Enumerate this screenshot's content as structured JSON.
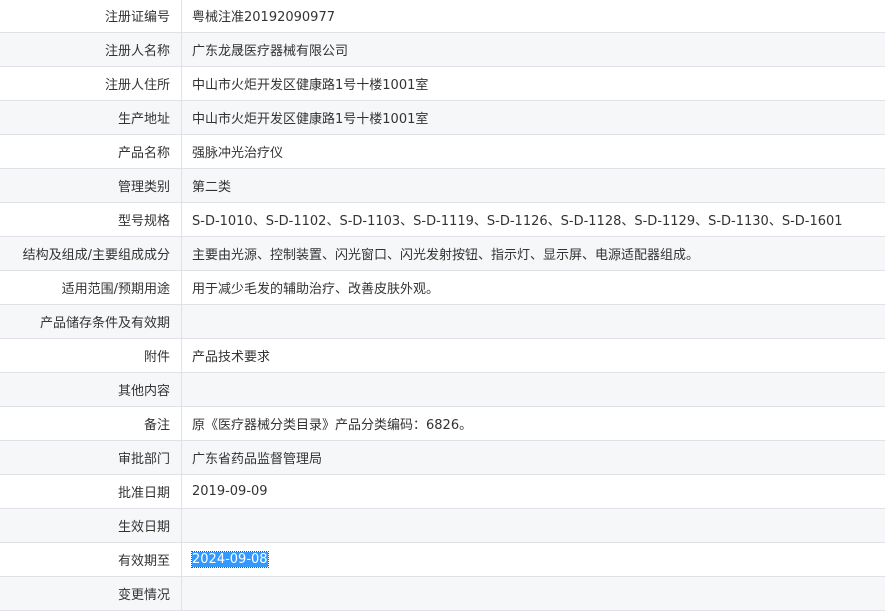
{
  "rows": [
    {
      "label": "注册证编号",
      "value": "粤械注准20192090977"
    },
    {
      "label": "注册人名称",
      "value": "广东龙晟医疗器械有限公司"
    },
    {
      "label": "注册人住所",
      "value": "中山市火炬开发区健康路1号十楼1001室"
    },
    {
      "label": "生产地址",
      "value": "中山市火炬开发区健康路1号十楼1001室"
    },
    {
      "label": "产品名称",
      "value": "强脉冲光治疗仪"
    },
    {
      "label": "管理类别",
      "value": "第二类"
    },
    {
      "label": "型号规格",
      "value": "S-D-1010、S-D-1102、S-D-1103、S-D-1119、S-D-1126、S-D-1128、S-D-1129、S-D-1130、S-D-1601"
    },
    {
      "label": "结构及组成/主要组成成分",
      "value": "主要由光源、控制装置、闪光窗口、闪光发射按钮、指示灯、显示屏、电源适配器组成。"
    },
    {
      "label": "适用范围/预期用途",
      "value": "用于减少毛发的辅助治疗、改善皮肤外观。"
    },
    {
      "label": "产品储存条件及有效期",
      "value": ""
    },
    {
      "label": "附件",
      "value": "产品技术要求"
    },
    {
      "label": "其他内容",
      "value": ""
    },
    {
      "label": "备注",
      "value": "原《医疗器械分类目录》产品分类编码：6826。"
    },
    {
      "label": "审批部门",
      "value": "广东省药品监督管理局"
    },
    {
      "label": "批准日期",
      "value": "2019-09-09"
    },
    {
      "label": "生效日期",
      "value": ""
    },
    {
      "label": "有效期至",
      "value": "2024-09-08"
    },
    {
      "label": "变更情况",
      "value": ""
    }
  ]
}
